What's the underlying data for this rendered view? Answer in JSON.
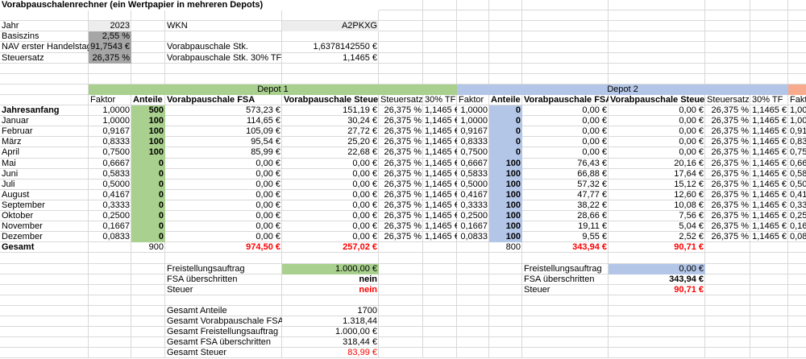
{
  "title": "Vorabpauschalenrechner (ein Wertpapier in mehreren Depots)",
  "inputs": {
    "jahr_label": "Jahr",
    "jahr": "2023",
    "basiszins_label": "Basiszins",
    "basiszins": "2,55 %",
    "nav_label": "NAV erster Handelstag",
    "nav": "91,7543 €",
    "steuersatz_label": "Steuersatz",
    "steuersatz": "26,375 %",
    "wkn_label": "WKN",
    "wkn": "A2PKXG",
    "vp_stk_label": "Vorabpauschale Stk.",
    "vp_stk": "1,6378142550 €",
    "vp_tf_label": "Vorabpauschale Stk. 30% TF",
    "vp_tf": "1,1465 €"
  },
  "headers": [
    "Faktor",
    "Anteile",
    "Vorabpauschale FSA",
    "Vorabpauschale Steuer",
    "Steuersatz",
    "30% TF"
  ],
  "months": [
    "Jahresanfang",
    "Januar",
    "Februar",
    "März",
    "April",
    "Mai",
    "Juni",
    "Juli",
    "August",
    "September",
    "Oktober",
    "November",
    "Dezember"
  ],
  "faktor": [
    "1,0000",
    "1,0000",
    "0,9167",
    "0,8333",
    "0,7500",
    "0,6667",
    "0,5833",
    "0,5000",
    "0,4167",
    "0,3333",
    "0,2500",
    "0,1667",
    "0,0833"
  ],
  "gesamt_label": "Gesamt",
  "depots": [
    {
      "name": "Depot 1",
      "color": "#a9d08e",
      "anteile": [
        "500",
        "100",
        "100",
        "100",
        "100",
        "0",
        "0",
        "0",
        "0",
        "0",
        "0",
        "0",
        "0"
      ],
      "fsa": [
        "573,23 €",
        "114,65 €",
        "105,09 €",
        "95,54 €",
        "85,99 €",
        "0,00 €",
        "0,00 €",
        "0,00 €",
        "0,00 €",
        "0,00 €",
        "0,00 €",
        "0,00 €",
        "0,00 €"
      ],
      "steuer": [
        "151,19 €",
        "30,24 €",
        "27,72 €",
        "25,20 €",
        "22,68 €",
        "0,00 €",
        "0,00 €",
        "0,00 €",
        "0,00 €",
        "0,00 €",
        "0,00 €",
        "0,00 €",
        "0,00 €"
      ],
      "steuersatz": "26,375 %",
      "tf": "1,1465 €",
      "total_anteile": "900",
      "total_fsa": "974,50 €",
      "total_steuer": "257,02 €",
      "freistellung_label": "Freistellungsauftrag",
      "freistellung": "1.000,00 €",
      "fsa_ueber_label": "FSA überschritten",
      "fsa_ueber": "nein",
      "steuer_label": "Steuer",
      "steuer_value": "nein"
    },
    {
      "name": "Depot 2",
      "color": "#b4c6e7",
      "anteile": [
        "0",
        "0",
        "0",
        "0",
        "0",
        "100",
        "100",
        "100",
        "100",
        "100",
        "100",
        "100",
        "100"
      ],
      "fsa": [
        "0,00 €",
        "0,00 €",
        "0,00 €",
        "0,00 €",
        "0,00 €",
        "76,43 €",
        "66,88 €",
        "57,32 €",
        "47,77 €",
        "38,22 €",
        "28,66 €",
        "19,11 €",
        "9,55 €"
      ],
      "steuer": [
        "0,00 €",
        "0,00 €",
        "0,00 €",
        "0,00 €",
        "0,00 €",
        "20,16 €",
        "17,64 €",
        "15,12 €",
        "12,60 €",
        "10,08 €",
        "7,56 €",
        "5,04 €",
        "2,52 €"
      ],
      "steuersatz": "26,375 %",
      "tf": "1,1465 €",
      "total_anteile": "800",
      "total_fsa": "343,94 €",
      "total_steuer": "90,71 €",
      "freistellung_label": "Freistellungsauftrag",
      "freistellung": "0,00 €",
      "fsa_ueber_label": "FSA überschritten",
      "fsa_ueber": "343,94 €",
      "steuer_label": "Steuer",
      "steuer_value": "90,71 €"
    }
  ],
  "depot3": {
    "color": "#f8ab8c",
    "header": "Faktor"
  },
  "summary": [
    {
      "label": "Gesamt Anteile",
      "value": "1700"
    },
    {
      "label": "Gesamt Vorabpauschale FSA",
      "value": "1.318,44"
    },
    {
      "label": "Gesamt Freistellungsauftrag",
      "value": "1.000,00 €"
    },
    {
      "label": "Gesamt FSA überschritten",
      "value": "318,44 €"
    },
    {
      "label": "Gesamt Steuer",
      "value": "83,99 €"
    }
  ]
}
